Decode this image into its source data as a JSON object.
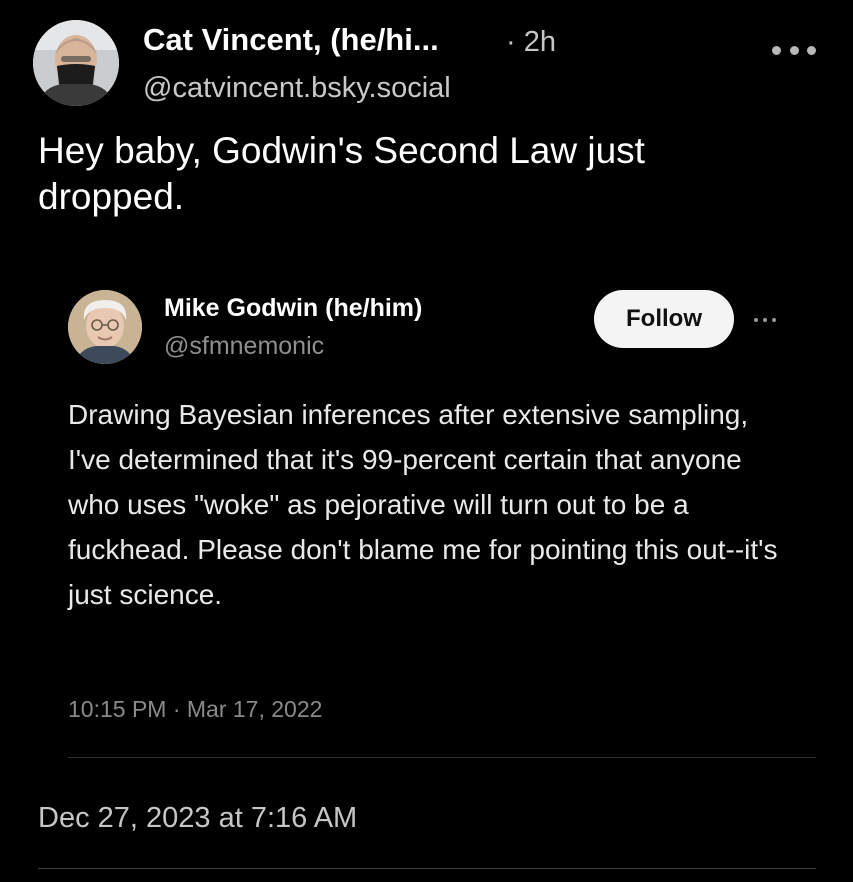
{
  "post": {
    "author": {
      "display_name": "Cat Vincent, (he/hi...",
      "handle": "@catvincent.bsky.social",
      "avatar_icon": "user-avatar"
    },
    "relative_time": "· 2h",
    "more_icon": "more-horizontal-icon",
    "text": "Hey baby, Godwin's Second Law just dropped.",
    "datetime": "Dec 27, 2023 at 7:16 AM"
  },
  "quote": {
    "author": {
      "display_name": "Mike Godwin (he/him)",
      "handle": "@sfmnemonic",
      "avatar_icon": "user-avatar"
    },
    "follow_label": "Follow",
    "more_icon": "more-horizontal-icon",
    "text": "Drawing Bayesian inferences after extensive sampling, I've determined that it's 99-percent certain that anyone who uses \"woke\" as pejorative will turn out to be a fuckhead. Please don't blame me for pointing this out--it's just science.",
    "timestamp": "10:15 PM · Mar 17, 2022"
  },
  "colors": {
    "background": "#000000",
    "primary_text": "#ffffff",
    "secondary_text": "#c6c6c6",
    "muted_text": "#8a8a8a",
    "follow_button_bg": "#f4f4f4"
  }
}
